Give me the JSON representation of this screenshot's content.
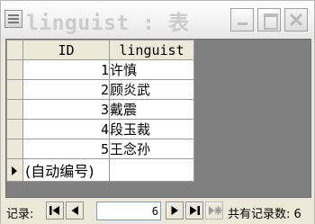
{
  "window": {
    "title": "linguist : 表"
  },
  "table": {
    "columns": [
      "ID",
      "linguist"
    ],
    "rows": [
      {
        "id": "1",
        "linguist": "许慎"
      },
      {
        "id": "2",
        "linguist": "顾炎武"
      },
      {
        "id": "3",
        "linguist": "戴震"
      },
      {
        "id": "4",
        "linguist": "段玉裁"
      },
      {
        "id": "5",
        "linguist": "王念孙"
      }
    ],
    "new_row_placeholder": "(自动编号)"
  },
  "statusbar": {
    "record_label": "记录:",
    "current_record": "6",
    "total_label": "共有记录数: 6"
  },
  "colors": {
    "grid_background": "#808080",
    "chrome": "#ece9d8",
    "title_text": "#cccccc"
  }
}
